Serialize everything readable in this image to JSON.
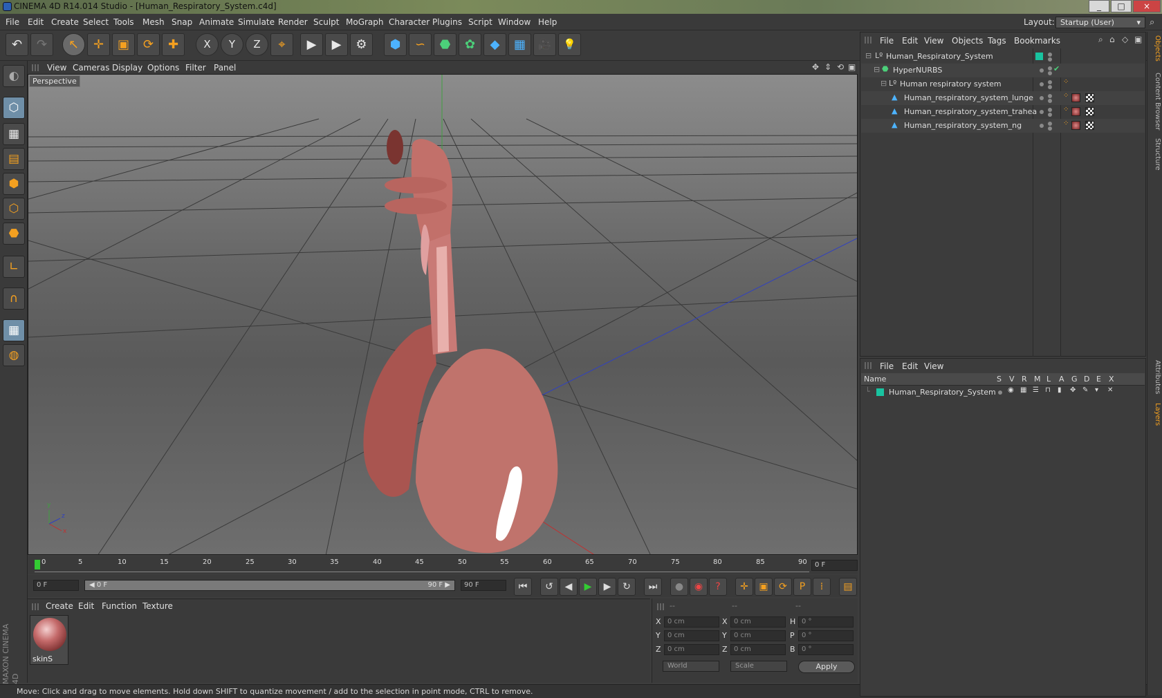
{
  "window": {
    "title": "CINEMA 4D R14.014 Studio - [Human_Respiratory_System.c4d]",
    "minimize": "_",
    "maximize": "□",
    "close": "×"
  },
  "menubar": {
    "items": [
      "File",
      "Edit",
      "Create",
      "Select",
      "Tools",
      "Mesh",
      "Snap",
      "Animate",
      "Simulate",
      "Render",
      "Sculpt",
      "MoGraph",
      "Character",
      "Plugins",
      "Script",
      "Window",
      "Help"
    ],
    "layout_label": "Layout:",
    "layout_value": "Startup (User)"
  },
  "toolbar": {
    "undo": "↶",
    "redo": "↷",
    "live_select": "↖",
    "move": "✛",
    "scale": "▣",
    "rotate": "⟳",
    "add": "✚",
    "axis_x": "X",
    "axis_y": "Y",
    "axis_z": "Z",
    "world_coord": "⌖",
    "render_view": "▶",
    "render_picture": "▶",
    "render_settings": "⚙",
    "cube": "⬢",
    "spline": "∽",
    "nurbs": "⬣",
    "array": "✿",
    "deformer": "◆",
    "scene": "▦",
    "camera": "🎥",
    "light": "💡"
  },
  "viewport": {
    "menu": [
      "View",
      "Cameras",
      "Display",
      "Options",
      "Filter",
      "Panel"
    ],
    "label": "Perspective",
    "axis_x": "x",
    "axis_y": "y",
    "axis_z": "z"
  },
  "timeline": {
    "ticks": [
      "0",
      "5",
      "10",
      "15",
      "20",
      "25",
      "30",
      "35",
      "40",
      "45",
      "50",
      "55",
      "60",
      "65",
      "70",
      "75",
      "80",
      "85",
      "90"
    ],
    "current_frame": "0 F",
    "start_field": "0 F",
    "range_start": "◀ 0 F",
    "range_end": "90 F ▶",
    "end_field": "90 F"
  },
  "transport": {
    "first": "⏮",
    "prev_key": "↺",
    "prev_frame": "◀",
    "play": "▶",
    "next_frame": "▶",
    "next_key": "↻",
    "last": "⏭",
    "record": "●",
    "autokey": "◉",
    "help": "?",
    "move_key": "✛",
    "scale_key": "▣",
    "rotate_key": "⟳",
    "pla_key": "P",
    "points": "⁞",
    "timeline_btn": "▤"
  },
  "materials": {
    "menu": [
      "Create",
      "Edit",
      "Function",
      "Texture"
    ],
    "items": [
      {
        "name": "skinS"
      }
    ]
  },
  "coords": {
    "header": [
      "--",
      "--",
      "--"
    ],
    "rows": [
      {
        "a": "X",
        "av": "0 cm",
        "b": "X",
        "bv": "0 cm",
        "c": "H",
        "cv": "0 °"
      },
      {
        "a": "Y",
        "av": "0 cm",
        "b": "Y",
        "bv": "0 cm",
        "c": "P",
        "cv": "0 °"
      },
      {
        "a": "Z",
        "av": "0 cm",
        "b": "Z",
        "bv": "0 cm",
        "c": "B",
        "cv": "0 °"
      }
    ],
    "world": "World",
    "scale": "Scale",
    "apply": "Apply"
  },
  "status": "Move: Click and drag to move elements. Hold down SHIFT to quantize movement / add to the selection in point mode, CTRL to remove.",
  "objects": {
    "menu": [
      "File",
      "Edit",
      "View",
      "Objects",
      "Tags",
      "Bookmarks"
    ],
    "rows": [
      {
        "name": "Human_Respiratory_System",
        "indent": 0
      },
      {
        "name": "HyperNURBS",
        "indent": 1
      },
      {
        "name": "Human respiratory system",
        "indent": 2
      },
      {
        "name": "Human_respiratory_system_lunge",
        "indent": 3
      },
      {
        "name": "Human_respiratory_system_trahea",
        "indent": 3
      },
      {
        "name": "Human_respiratory_system_ng",
        "indent": 3
      }
    ],
    "check": "✔"
  },
  "layers": {
    "menu": [
      "File",
      "Edit",
      "View"
    ],
    "columns": [
      "Name",
      "S",
      "V",
      "R",
      "M",
      "L",
      "A",
      "G",
      "D",
      "E",
      "X"
    ],
    "rows": [
      {
        "name": "Human_Respiratory_System"
      }
    ]
  },
  "right_tabs": [
    "Objects",
    "Content Browser",
    "Structure",
    "Attributes",
    "Layers"
  ],
  "brand": "MAXON CINEMA 4D",
  "colors": {
    "accent": "#f4a020",
    "layer": "#19c3a0",
    "axis_y": "#3fa040",
    "axis_x": "#c03030",
    "axis_z": "#3040c0"
  }
}
